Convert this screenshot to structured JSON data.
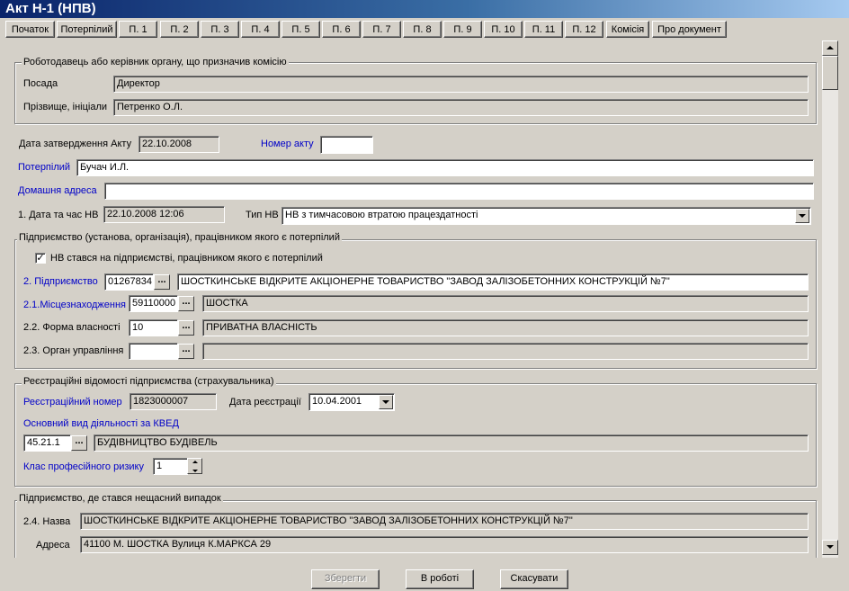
{
  "window": {
    "title": "Акт Н-1 (НПВ)"
  },
  "tabs": [
    "Початок",
    "Потерпілий",
    "П. 1",
    "П. 2",
    "П. 3",
    "П. 4",
    "П. 5",
    "П. 6",
    "П. 7",
    "П. 8",
    "П. 9",
    "П. 10",
    "П. 11",
    "П. 12",
    "Комісія",
    "Про документ"
  ],
  "employer_group": {
    "title": "Роботодавець або керівник органу, що призначив комісію",
    "position_label": "Посада",
    "position_value": "Директор",
    "name_label": "Прізвище, ініціали",
    "name_value": "Петренко О.Л."
  },
  "act": {
    "approval_date_label": "Дата затвердження Акту",
    "approval_date_value": "22.10.2008",
    "number_label": "Номер акту",
    "number_value": "",
    "victim_label": "Потерпілий",
    "victim_value": "Бучач И.Л.",
    "home_address_label": "Домашня адреса",
    "home_address_value": "",
    "datetime_label": "1. Дата та час НВ",
    "datetime_value": "22.10.2008 12:06",
    "type_label": "Тип НВ",
    "type_value": "НВ з тимчасовою втратою працездатності"
  },
  "enterprise_group": {
    "title": "Підприємство (установа, організація), працівником якого є потерпілий",
    "checkbox_label": "НВ стався на підприємстві, працівником якого є потерпілий",
    "checkbox_checked": "✓",
    "enterprise_label": "2. Підприємство",
    "enterprise_code": "01267834",
    "enterprise_name": "ШОСТКИНСЬКЕ ВІДКРИТЕ АКЦІОНЕРНЕ ТОВАРИСТВО \"ЗАВОД ЗАЛІЗОБЕТОННИХ КОНСТРУКЦІЙ №7\"",
    "location_label": "2.1.Місцезнаходження",
    "location_code": "59110000",
    "location_name": "ШОСТКА",
    "ownership_label": "2.2. Форма власності",
    "ownership_code": "10",
    "ownership_name": "ПРИВАТНА ВЛАСНІСТЬ",
    "management_label": "2.3. Орган управління",
    "management_code": "",
    "management_name": ""
  },
  "registration_group": {
    "title": "Реєстраційні відомості підприємства (страхувальника)",
    "reg_number_label": "Реєстраційний номер",
    "reg_number_value": "1823000007",
    "reg_date_label": "Дата реєстрації",
    "reg_date_value": "10.04.2001",
    "kved_label": "Основний вид діяльності за КВЕД",
    "kved_code": "45.21.1",
    "kved_name": "БУДІВНИЦТВО БУДІВЕЛЬ",
    "risk_label": "Клас професійного ризику",
    "risk_value": "1"
  },
  "accident_group": {
    "title": "Підприємство, де стався нещасний випадок",
    "name_label": "2.4. Назва",
    "name_value": "ШОСТКИНСЬКЕ ВІДКРИТЕ АКЦІОНЕРНЕ ТОВАРИСТВО \"ЗАВОД ЗАЛІЗОБЕТОННИХ КОНСТРУКЦІЙ №7\"",
    "address_label": "Адреса",
    "address_value": "41100 М. ШОСТКА Вулиця К.МАРКСА 29"
  },
  "buttons": {
    "save": "Зберегти",
    "in_work": "В роботі",
    "cancel": "Скасувати"
  },
  "icons": {
    "ellipsis": "...",
    "dropdown": "chevron-down-icon",
    "check": "check-icon"
  }
}
